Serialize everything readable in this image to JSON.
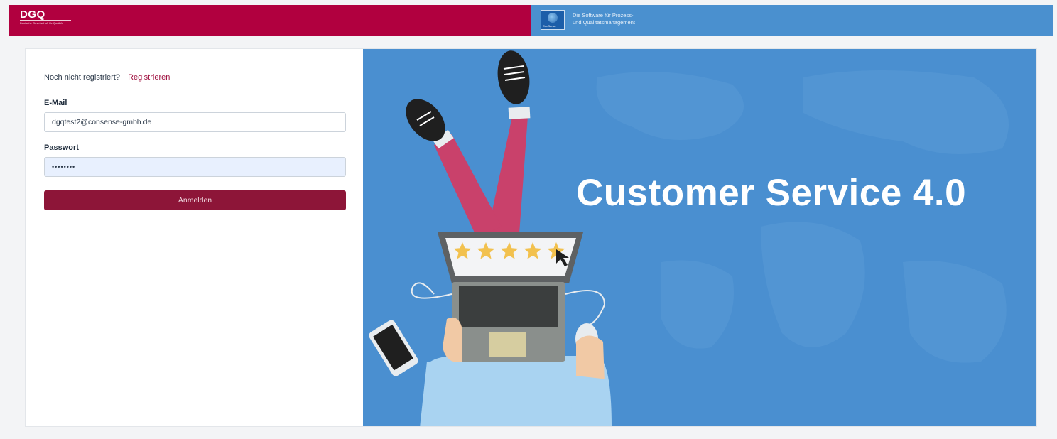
{
  "header": {
    "left_logo": "DGQ",
    "left_logo_subtext": "Deutsche Gesellschaft für Qualität",
    "right_logo_label": "ConSense",
    "tagline_line1": "Die Software für Prozess-",
    "tagline_line2": "und Qualitätsmanagement"
  },
  "form": {
    "not_registered_text": "Noch nicht registriert?",
    "register_link": "Registrieren",
    "email_label": "E-Mail",
    "email_value": "dgqtest2@consense-gmbh.de",
    "password_label": "Passwort",
    "password_value": "••••••••",
    "login_button": "Anmelden"
  },
  "hero": {
    "title": "Customer Service 4.0",
    "rating_stars": 5
  },
  "colors": {
    "brand_red": "#b1003f",
    "button": "#8d1538",
    "hero_blue": "#4a8fd0"
  }
}
